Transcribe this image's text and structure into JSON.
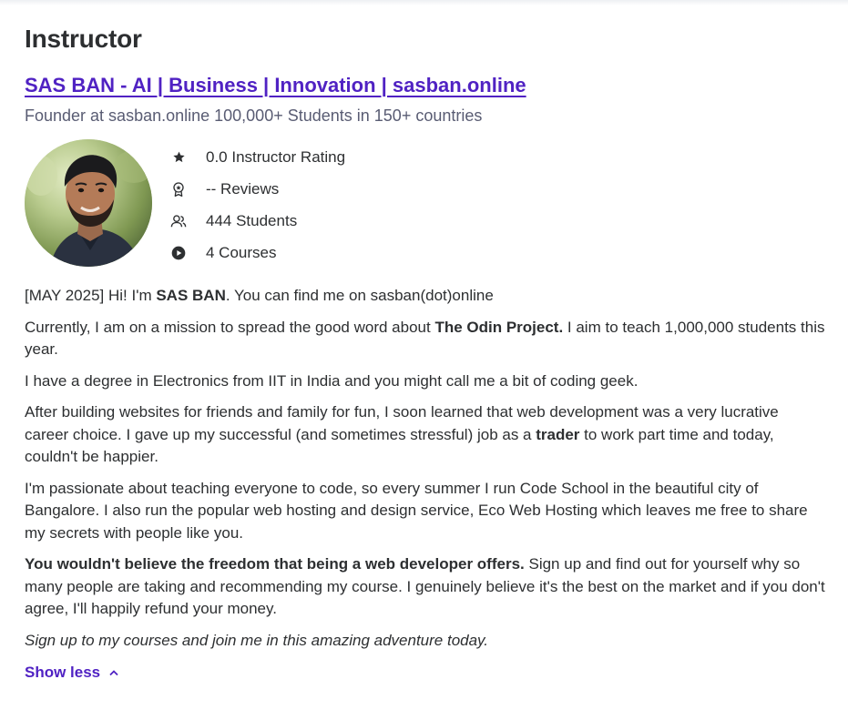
{
  "section_title": "Instructor",
  "instructor": {
    "name": "SAS BAN - AI | Business | Innovation | sasban.online",
    "headline": "Founder at sasban.online 100,000+ Students in 150+ countries"
  },
  "stats": [
    {
      "icon": "star-icon",
      "label": "0.0 Instructor Rating"
    },
    {
      "icon": "award-ribbon-icon",
      "label": "-- Reviews"
    },
    {
      "icon": "users-icon",
      "label": "444 Students"
    },
    {
      "icon": "play-circle-icon",
      "label": "4 Courses"
    }
  ],
  "bio": {
    "p1": {
      "a": "[MAY 2025] Hi! I'm ",
      "b": "SAS BAN",
      "c": ". You can find me on sasban(dot)online"
    },
    "p2": {
      "a": "Currently, I am on a mission to spread the good word about ",
      "b": "The Odin Project.",
      "c": " I aim to teach 1,000,000 students this year."
    },
    "p3": "I have a degree in Electronics from IIT in India and you might call me a bit of coding geek.",
    "p4": {
      "a": "After building websites for friends and family for fun, I soon learned that web development was a very lucrative career choice. I gave up my successful (and sometimes stressful) job as a ",
      "b": "trader",
      "c": " to work part time and today, couldn't be happier."
    },
    "p5": "I'm passionate about teaching everyone to code, so every summer I run Code School in the beautiful city of Bangalore. I also run the popular web hosting and design service, Eco Web Hosting which leaves me free to share my secrets with people like you.",
    "p6": {
      "b": "You wouldn't believe the freedom that being a web developer offers.",
      "c": " Sign up and find out for yourself why so many people are taking and recommending my course. I genuinely believe it's the best on the market and if you don't agree, I'll happily refund your money."
    },
    "p7": "Sign up to my courses and join me in this amazing adventure today."
  },
  "show_less_label": "Show less",
  "colors": {
    "link": "#5022c3",
    "text": "#2d2f31",
    "muted": "#595c73"
  }
}
